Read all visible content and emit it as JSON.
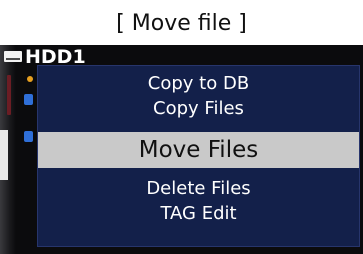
{
  "caption": "[ Move file ]",
  "screen": {
    "location": "HDD1",
    "location_icon": "hdd-icon"
  },
  "context_menu": {
    "items": [
      {
        "label": "Copy to DB",
        "selected": false
      },
      {
        "label": "Copy Files",
        "selected": false
      },
      {
        "label": "Move Files",
        "selected": true
      },
      {
        "label": "Delete Files",
        "selected": false
      },
      {
        "label": "TAG Edit",
        "selected": false
      }
    ]
  },
  "colors": {
    "menu_background": "#13204a",
    "selection_highlight": "#c9c9c9",
    "screen_background": "#0b0b0d"
  }
}
